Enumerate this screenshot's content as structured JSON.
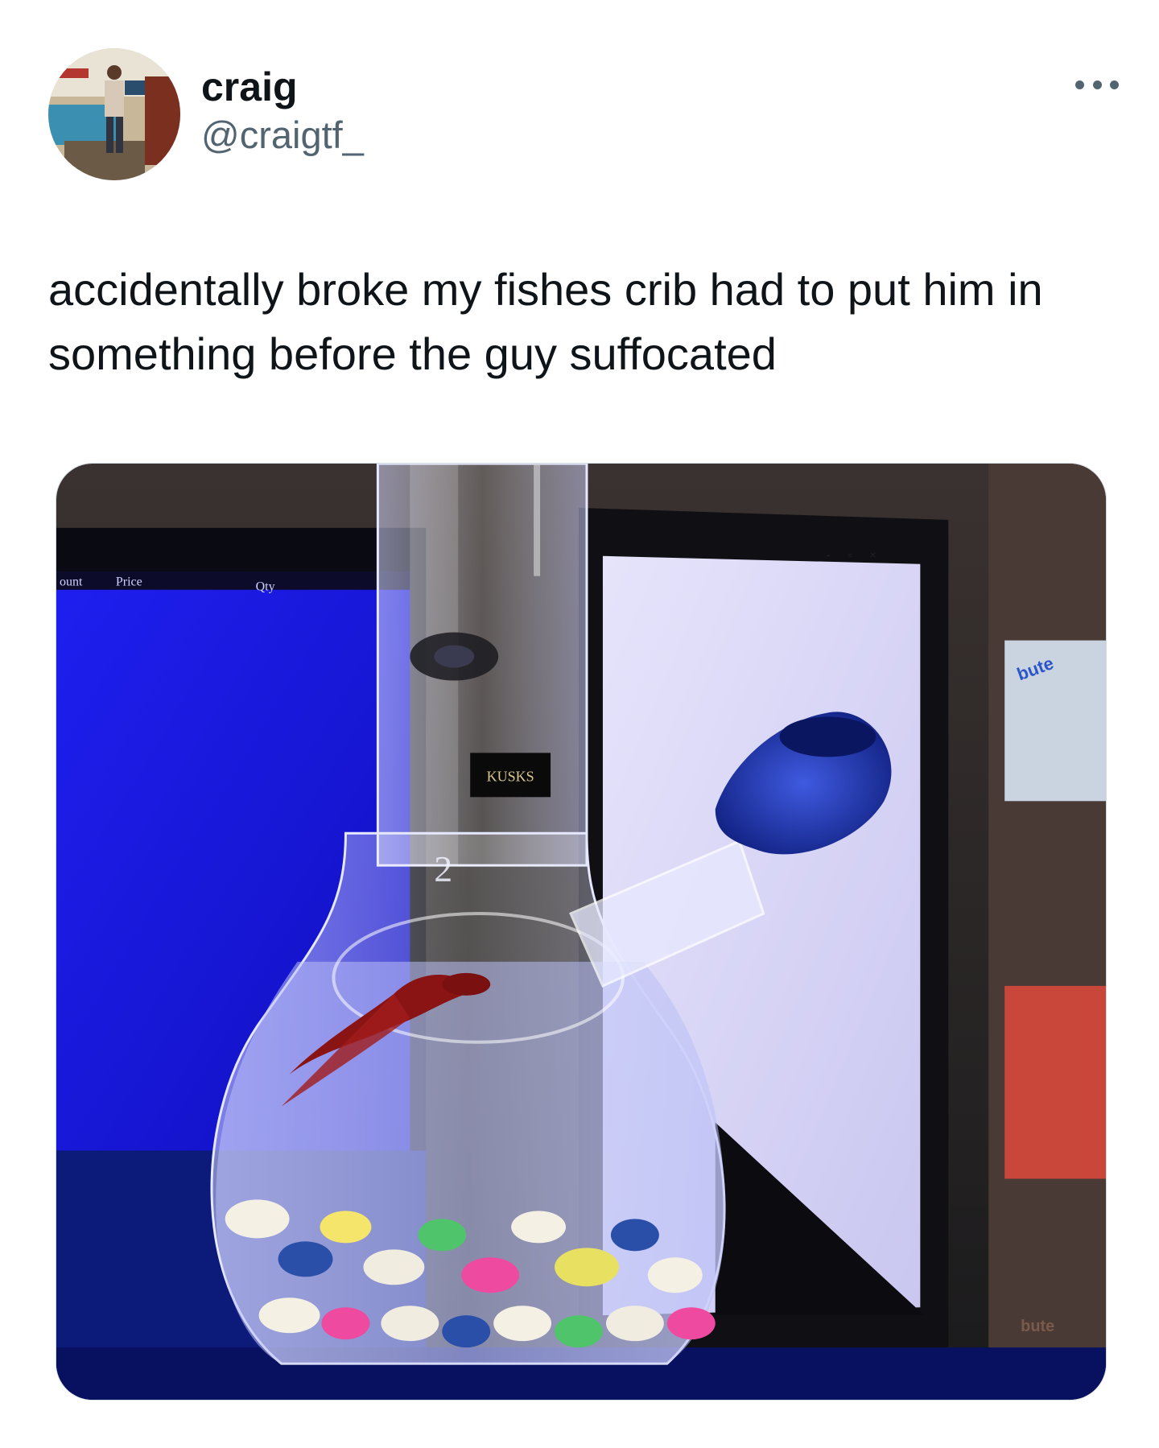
{
  "author": {
    "display_name": "craig",
    "handle": "@craigtf_",
    "avatar_icon": "user-avatar"
  },
  "menu": {
    "more_icon": "more-horizontal-icon"
  },
  "tweet": {
    "text": "accidentally broke my fishes crib had to put him in something before the guy suffocated"
  },
  "photo": {
    "screen_columns": [
      "ount",
      "Price",
      "Qty"
    ],
    "label": "KUSKS",
    "number_mark": "2",
    "window_controls": [
      "-",
      "▫",
      "×"
    ],
    "shelf_text": [
      "bute",
      "bute"
    ]
  },
  "colors": {
    "handle": "#536471",
    "text": "#0f1419",
    "monitor_blue": "#1818e8",
    "glass_blue": "#1c2fa8",
    "fish_red": "#8a1414"
  }
}
